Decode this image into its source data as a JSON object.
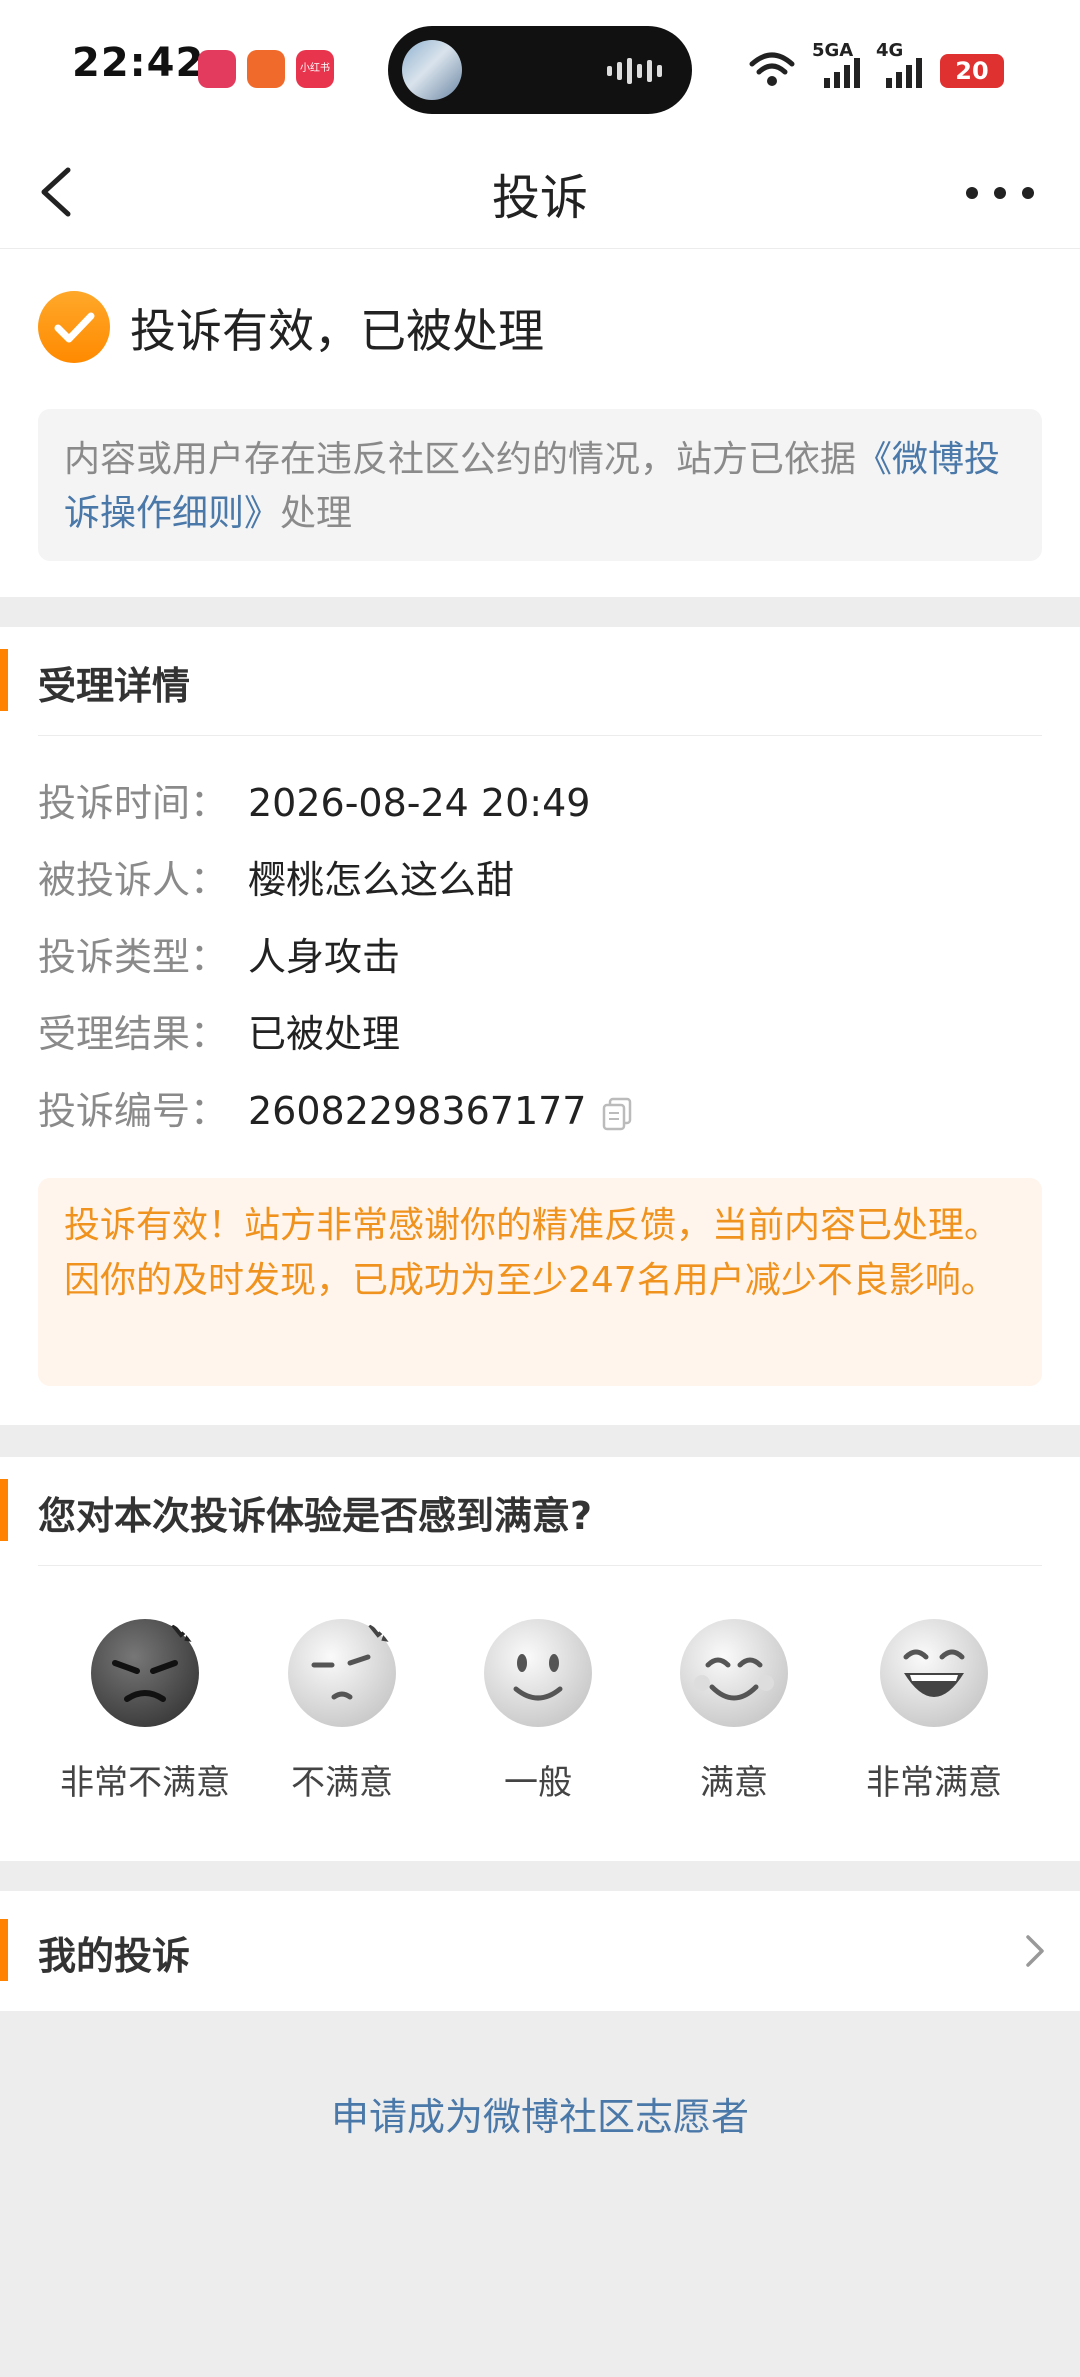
{
  "status_bar": {
    "time": "22:42",
    "app_icon_label": "小红书",
    "signal_1": "5GA",
    "signal_2": "4G",
    "battery": "20"
  },
  "header": {
    "title": "投诉",
    "back_icon": "chevron-left-icon",
    "more_icon": "more-dots-icon"
  },
  "result": {
    "status_icon": "check-circle-icon",
    "title": "投诉有效，已被处理",
    "notice_prefix": "内容或用户存在违反社区公约的情况，站方已依据",
    "notice_link": "《微博投诉操作细则》",
    "notice_suffix": "处理"
  },
  "details": {
    "section_title": "受理详情",
    "rows": [
      {
        "label": "投诉时间：",
        "value": "2026-08-24 20:49"
      },
      {
        "label": "被投诉人：",
        "value": "樱桃怎么这么甜"
      },
      {
        "label": "投诉类型：",
        "value": "人身攻击"
      },
      {
        "label": "受理结果：",
        "value": "已被处理"
      },
      {
        "label": "投诉编号：",
        "value": "26082298367177"
      }
    ],
    "effect_text": "投诉有效！站方非常感谢你的精准反馈，当前内容已处理。因你的及时发现，已成功为至少247名用户减少不良影响。"
  },
  "satisfaction": {
    "title": "您对本次投诉体验是否感到满意?",
    "options": [
      {
        "label": "非常不满意",
        "icon": "very-dissatisfied-face-icon"
      },
      {
        "label": "不满意",
        "icon": "dissatisfied-face-icon"
      },
      {
        "label": "一般",
        "icon": "neutral-face-icon"
      },
      {
        "label": "满意",
        "icon": "satisfied-face-icon"
      },
      {
        "label": "非常满意",
        "icon": "very-satisfied-face-icon"
      }
    ]
  },
  "my_complaints": {
    "title": "我的投诉"
  },
  "volunteer_link": "申请成为微博社区志愿者",
  "colors": {
    "accent": "#ff8200",
    "link": "#4a78a8",
    "effect_text": "#f0921e",
    "effect_bg": "#fff5ec"
  }
}
